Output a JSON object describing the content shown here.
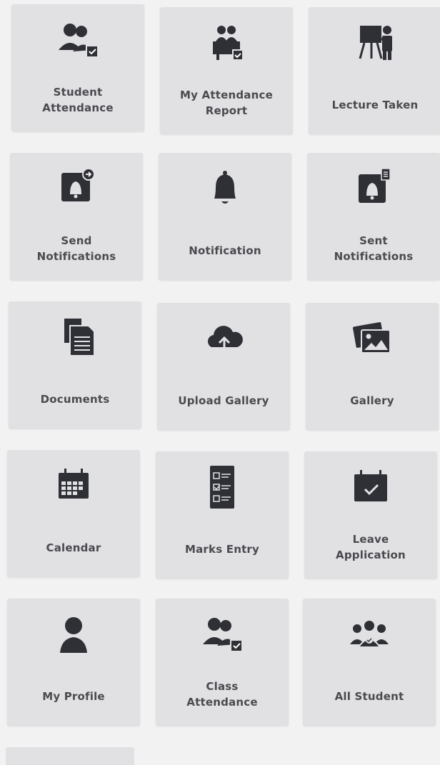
{
  "menu": {
    "tiles": [
      {
        "label": "Student\nAttendance",
        "icon": "student-attendance-icon"
      },
      {
        "label": "My Attendance\nReport",
        "icon": "attendance-report-icon"
      },
      {
        "label": "Lecture Taken",
        "icon": "lecture-icon"
      },
      {
        "label": "Send\nNotifications",
        "icon": "send-notification-icon"
      },
      {
        "label": "Notification",
        "icon": "bell-icon"
      },
      {
        "label": "Sent\nNotifications",
        "icon": "sent-notification-icon"
      },
      {
        "label": "Documents",
        "icon": "documents-icon"
      },
      {
        "label": "Upload Gallery",
        "icon": "cloud-upload-icon"
      },
      {
        "label": "Gallery",
        "icon": "gallery-icon"
      },
      {
        "label": "Calendar",
        "icon": "calendar-icon"
      },
      {
        "label": "Marks Entry",
        "icon": "checklist-icon"
      },
      {
        "label": "Leave\nApplication",
        "icon": "calendar-check-icon"
      },
      {
        "label": "My Profile",
        "icon": "user-icon"
      },
      {
        "label": "Class\nAttendance",
        "icon": "class-attendance-icon"
      },
      {
        "label": "All Student",
        "icon": "group-icon"
      }
    ]
  },
  "colors": {
    "tile_bg": "#e1e1e4",
    "icon": "#2e3036",
    "label": "#4a4a4f",
    "page_bg": "#f2f2f3"
  }
}
